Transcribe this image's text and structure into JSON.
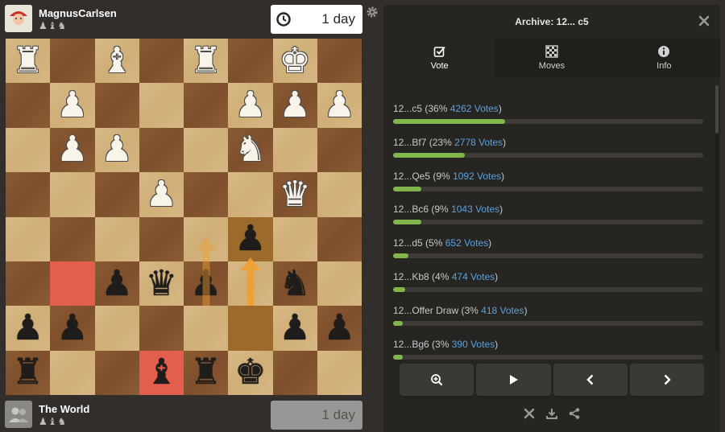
{
  "top_player": {
    "name": "MagnusCarlsen",
    "captured": "♟♝♞",
    "clock": "1 day"
  },
  "bottom_player": {
    "name": "The World",
    "captured": "♟♝♞",
    "clock": "1 day"
  },
  "panel": {
    "title": "Archive: 12... c5",
    "tabs": [
      {
        "label": "Vote",
        "icon": "checkbox-icon"
      },
      {
        "label": "Moves",
        "icon": "board-icon"
      },
      {
        "label": "Info",
        "icon": "info-icon"
      }
    ],
    "votes": [
      {
        "move": "12...c5",
        "pct": "36%",
        "votes": "4262 Votes",
        "fraction": 0.36
      },
      {
        "move": "12...Bf7",
        "pct": "23%",
        "votes": "2778 Votes",
        "fraction": 0.23
      },
      {
        "move": "12...Qe5",
        "pct": "9%",
        "votes": "1092 Votes",
        "fraction": 0.09
      },
      {
        "move": "12...Bc6",
        "pct": "9%",
        "votes": "1043 Votes",
        "fraction": 0.09
      },
      {
        "move": "12...d5",
        "pct": "5%",
        "votes": "652 Votes",
        "fraction": 0.05
      },
      {
        "move": "12...Kb8",
        "pct": "4%",
        "votes": "474 Votes",
        "fraction": 0.04
      },
      {
        "move": "12...Offer Draw",
        "pct": "3%",
        "votes": "418 Votes",
        "fraction": 0.03
      },
      {
        "move": "12...Bg6",
        "pct": "3%",
        "votes": "390 Votes",
        "fraction": 0.03
      }
    ]
  },
  "board": {
    "ranks": [
      [
        "wR",
        "",
        "wB",
        "",
        "wR",
        "",
        "wK",
        ""
      ],
      [
        "",
        "wP",
        "",
        "",
        "",
        "wP",
        "wP",
        "wP"
      ],
      [
        "",
        "wP",
        "wP",
        "",
        "",
        "wN",
        "",
        ""
      ],
      [
        "",
        "",
        "",
        "wP",
        "",
        "",
        "wQ",
        ""
      ],
      [
        "",
        "",
        "",
        "",
        "",
        "bP",
        "",
        ""
      ],
      [
        "",
        "",
        "bP",
        "bQ",
        "bP",
        "",
        "bN",
        ""
      ],
      [
        "bP",
        "bP",
        "",
        "",
        "",
        "",
        "bP",
        "bP"
      ],
      [
        "bR",
        "",
        "",
        "bB",
        "bR",
        "bK",
        "",
        ""
      ]
    ],
    "highlights": {
      "red": [
        "5-1",
        "7-3"
      ],
      "orange": [
        "4-5",
        "6-5"
      ]
    }
  },
  "colors": {
    "accent_green": "#81b64c",
    "link_blue": "#5aa0e0",
    "highlight_red": "#e35f4d",
    "arrow_orange": "#f0a032"
  }
}
